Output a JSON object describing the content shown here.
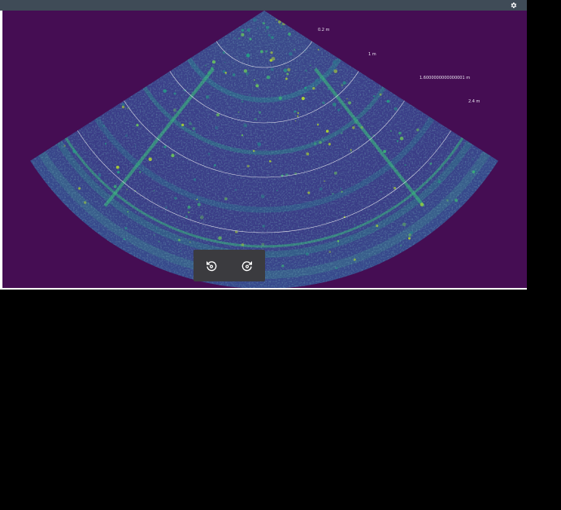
{
  "toolbar": {
    "settings_icon": "gear-icon",
    "colors": {
      "bar": "#3f4b57",
      "icon": "#ffffff"
    }
  },
  "sonar": {
    "colormap": "viridis",
    "background_color": "#450d53",
    "range_ring_color": "#dcdce6",
    "range_labels": [
      "0.2 m",
      "1 m",
      "1.6000000000000001 m",
      "2.4 m"
    ]
  },
  "controls": {
    "rotate_left_icon": "rotate-counterclockwise-icon",
    "rotate_right_icon": "rotate-clockwise-icon",
    "panel_color": "#3b3b3f"
  }
}
